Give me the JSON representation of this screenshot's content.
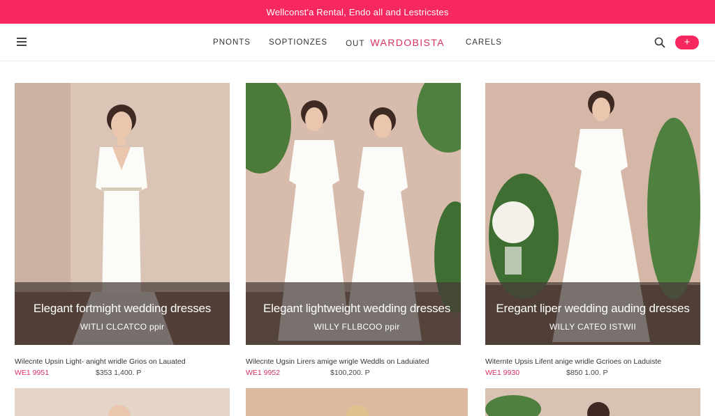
{
  "promo": {
    "text": "Wellconst'a Rental, Endo all and Lestricstes"
  },
  "nav": {
    "links": [
      "PNONTS",
      "SOPTIONZES"
    ],
    "brand_prefix": "OUT",
    "brand": "WARDOBISTA",
    "link_after": "CARELS"
  },
  "icons": {
    "menu": "hamburger-icon",
    "search": "search-icon",
    "add": "plus-icon"
  },
  "colors": {
    "accent": "#f7275f",
    "brand": "#d9305f"
  },
  "products": [
    {
      "title": "Elegant fortmight wedding dresses",
      "subtitle": "WITLI CLCATCO ppir",
      "description": "Wilecnte Upsin Light- anight wridle Grios on Lauated",
      "sku": "WE1 9951",
      "price": "$353 1,400. P"
    },
    {
      "title": "Elegant lightweight wedding dresses",
      "subtitle": "WILLY FLLBCOO ppir",
      "description": "Wilecnte Ugsin Lirers amige wrigle Weddls on Laduiated",
      "sku": "WE1 9952",
      "price": "$100,200. P"
    },
    {
      "title": "Eregant liper wedding auding dresses",
      "subtitle": "WILLY CATEO ISTWII",
      "description": "Witernte Upsis Lifent anige wridle Gcrioes on Laduiste",
      "sku": "WE1 9930",
      "price": "$850 1.00. P"
    }
  ]
}
